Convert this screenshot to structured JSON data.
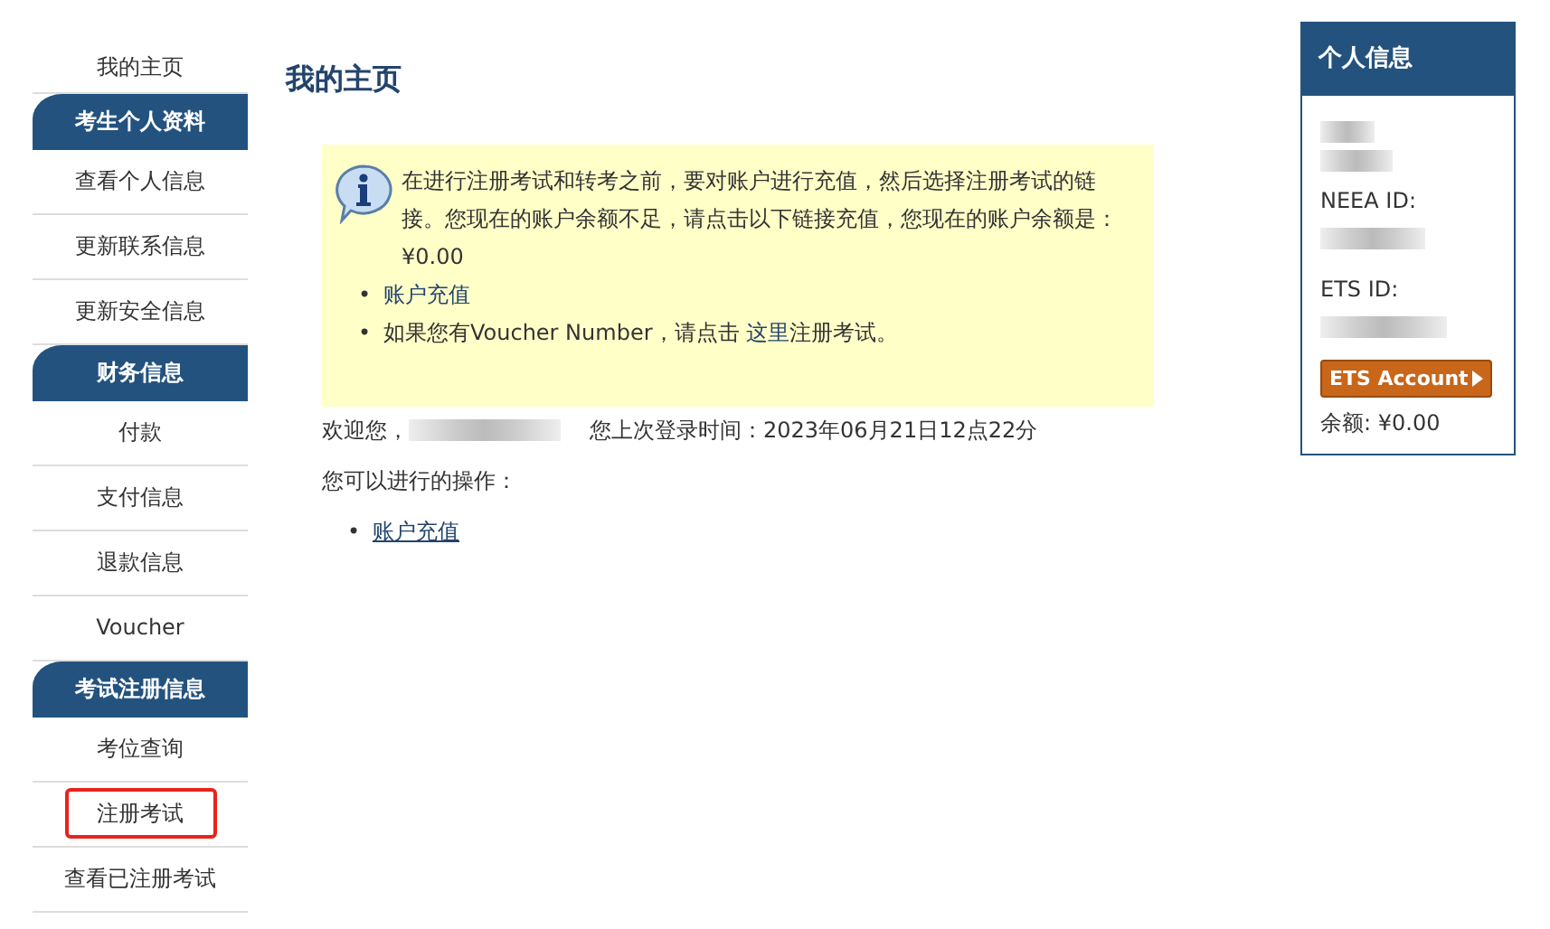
{
  "sidebar": {
    "items": [
      {
        "kind": "link",
        "label": "我的主页",
        "highlighted": false
      },
      {
        "kind": "header",
        "label": "考生个人资料"
      },
      {
        "kind": "link",
        "label": "查看个人信息",
        "highlighted": false
      },
      {
        "kind": "link",
        "label": "更新联系信息",
        "highlighted": false
      },
      {
        "kind": "link",
        "label": "更新安全信息",
        "highlighted": false
      },
      {
        "kind": "header",
        "label": "财务信息"
      },
      {
        "kind": "link",
        "label": "付款",
        "highlighted": false
      },
      {
        "kind": "link",
        "label": "支付信息",
        "highlighted": false
      },
      {
        "kind": "link",
        "label": "退款信息",
        "highlighted": false
      },
      {
        "kind": "link",
        "label": "Voucher",
        "highlighted": false
      },
      {
        "kind": "header",
        "label": "考试注册信息"
      },
      {
        "kind": "link",
        "label": "考位查询",
        "highlighted": false
      },
      {
        "kind": "link",
        "label": "注册考试",
        "highlighted": true
      },
      {
        "kind": "link",
        "label": "查看已注册考试",
        "highlighted": false
      }
    ]
  },
  "page_title": "我的主页",
  "notice": {
    "text": "在进行注册考试和转考之前，要对账户进行充值，然后选择注册考试的链接。您现在的账户余额不足，请点击以下链接充值，您现在的账户余额是：¥0.00",
    "bullets": [
      {
        "marker": "•",
        "parts": [
          {
            "kind": "link",
            "text": "账户充值"
          }
        ]
      },
      {
        "marker": "•",
        "parts": [
          {
            "kind": "text",
            "text": "如果您有Voucher Number，请点击"
          },
          {
            "kind": "link",
            "text": "这里"
          },
          {
            "kind": "text",
            "text": "注册考试。"
          }
        ]
      }
    ]
  },
  "welcome": {
    "greeting": "欢迎您，",
    "last_login": "您上次登录时间：2023年06月21日12点22分"
  },
  "actions_heading": "您可以进行的操作：",
  "actions": [
    {
      "marker": "•",
      "label": "账户充值"
    }
  ],
  "profile": {
    "title": "个人信息",
    "neea_label": "NEEA ID:",
    "ets_label": "ETS ID:",
    "button": "ETS Account",
    "balance": "余额: ¥0.00"
  }
}
